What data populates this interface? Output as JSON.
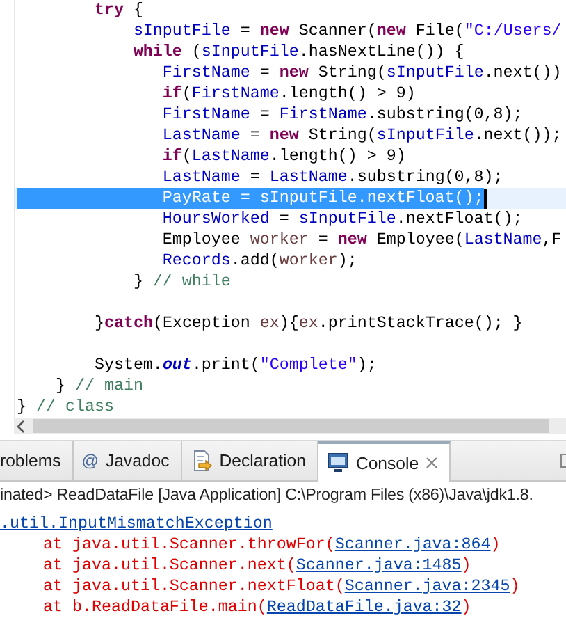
{
  "editor": {
    "lines": [
      {
        "kind": "code",
        "selected": false,
        "segments": [
          {
            "text": "        try",
            "kind": "keyword"
          },
          {
            "text": " {",
            "kind": "plain"
          }
        ]
      },
      {
        "kind": "code",
        "selected": false,
        "segments": [
          {
            "text": "            sInputFile",
            "kind": "field"
          },
          {
            "text": " = ",
            "kind": "plain"
          },
          {
            "text": "new",
            "kind": "keyword"
          },
          {
            "text": " Scanner(",
            "kind": "plain"
          },
          {
            "text": "new",
            "kind": "keyword"
          },
          {
            "text": " File(",
            "kind": "plain"
          },
          {
            "text": "\"C:/Users/",
            "kind": "string"
          }
        ]
      },
      {
        "kind": "code",
        "selected": false,
        "segments": [
          {
            "text": "            while",
            "kind": "keyword"
          },
          {
            "text": " (",
            "kind": "plain"
          },
          {
            "text": "sInputFile",
            "kind": "field"
          },
          {
            "text": ".hasNextLine()) {",
            "kind": "plain"
          }
        ]
      },
      {
        "kind": "code",
        "selected": false,
        "segments": [
          {
            "text": "               FirstName",
            "kind": "field"
          },
          {
            "text": " = ",
            "kind": "plain"
          },
          {
            "text": "new",
            "kind": "keyword"
          },
          {
            "text": " String(",
            "kind": "plain"
          },
          {
            "text": "sInputFile",
            "kind": "field"
          },
          {
            "text": ".next())",
            "kind": "plain"
          }
        ]
      },
      {
        "kind": "code",
        "selected": false,
        "segments": [
          {
            "text": "               if",
            "kind": "keyword"
          },
          {
            "text": "(",
            "kind": "plain"
          },
          {
            "text": "FirstName",
            "kind": "field"
          },
          {
            "text": ".length() > 9)",
            "kind": "plain"
          }
        ]
      },
      {
        "kind": "code",
        "selected": false,
        "segments": [
          {
            "text": "               FirstName",
            "kind": "field"
          },
          {
            "text": " = ",
            "kind": "plain"
          },
          {
            "text": "FirstName",
            "kind": "field"
          },
          {
            "text": ".substring(0,8);",
            "kind": "plain"
          }
        ]
      },
      {
        "kind": "code",
        "selected": false,
        "segments": [
          {
            "text": "               LastName",
            "kind": "field"
          },
          {
            "text": " = ",
            "kind": "plain"
          },
          {
            "text": "new",
            "kind": "keyword"
          },
          {
            "text": " String(",
            "kind": "plain"
          },
          {
            "text": "sInputFile",
            "kind": "field"
          },
          {
            "text": ".next());",
            "kind": "plain"
          }
        ]
      },
      {
        "kind": "code",
        "selected": false,
        "segments": [
          {
            "text": "               if",
            "kind": "keyword"
          },
          {
            "text": "(",
            "kind": "plain"
          },
          {
            "text": "LastName",
            "kind": "field"
          },
          {
            "text": ".length() > 9)",
            "kind": "plain"
          }
        ]
      },
      {
        "kind": "code",
        "selected": false,
        "segments": [
          {
            "text": "               LastName",
            "kind": "field"
          },
          {
            "text": " = ",
            "kind": "plain"
          },
          {
            "text": "LastName",
            "kind": "field"
          },
          {
            "text": ".substring(0,8);",
            "kind": "plain"
          }
        ]
      },
      {
        "kind": "code",
        "selected": true,
        "segments": [
          {
            "text": "               PayRate",
            "kind": "field"
          },
          {
            "text": " = ",
            "kind": "plain"
          },
          {
            "text": "sInputFile",
            "kind": "field"
          },
          {
            "text": ".nextFloat();",
            "kind": "plain"
          }
        ]
      },
      {
        "kind": "code",
        "selected": false,
        "segments": [
          {
            "text": "               HoursWorked",
            "kind": "field"
          },
          {
            "text": " = ",
            "kind": "plain"
          },
          {
            "text": "sInputFile",
            "kind": "field"
          },
          {
            "text": ".nextFloat();",
            "kind": "plain"
          }
        ]
      },
      {
        "kind": "code",
        "selected": false,
        "segments": [
          {
            "text": "               Employee ",
            "kind": "plain"
          },
          {
            "text": "worker",
            "kind": "local"
          },
          {
            "text": " = ",
            "kind": "plain"
          },
          {
            "text": "new",
            "kind": "keyword"
          },
          {
            "text": " Employee(",
            "kind": "plain"
          },
          {
            "text": "LastName",
            "kind": "field"
          },
          {
            "text": ",F",
            "kind": "plain"
          }
        ]
      },
      {
        "kind": "code",
        "selected": false,
        "segments": [
          {
            "text": "               Records",
            "kind": "field"
          },
          {
            "text": ".add(",
            "kind": "plain"
          },
          {
            "text": "worker",
            "kind": "local"
          },
          {
            "text": ");",
            "kind": "plain"
          }
        ]
      },
      {
        "kind": "code",
        "selected": false,
        "segments": [
          {
            "text": "            } ",
            "kind": "plain"
          },
          {
            "text": "// while",
            "kind": "comment"
          }
        ]
      },
      {
        "kind": "blank"
      },
      {
        "kind": "code",
        "selected": false,
        "segments": [
          {
            "text": "        }",
            "kind": "plain"
          },
          {
            "text": "catch",
            "kind": "keyword"
          },
          {
            "text": "(Exception ",
            "kind": "plain"
          },
          {
            "text": "ex",
            "kind": "local"
          },
          {
            "text": "){",
            "kind": "plain"
          },
          {
            "text": "ex",
            "kind": "local"
          },
          {
            "text": ".printStackTrace(); }",
            "kind": "plain"
          }
        ]
      },
      {
        "kind": "blank"
      },
      {
        "kind": "code",
        "selected": false,
        "segments": [
          {
            "text": "        System.",
            "kind": "plain"
          },
          {
            "text": "out",
            "kind": "static"
          },
          {
            "text": ".print(",
            "kind": "plain"
          },
          {
            "text": "\"Complete\"",
            "kind": "string"
          },
          {
            "text": ");",
            "kind": "plain"
          }
        ]
      },
      {
        "kind": "code",
        "selected": false,
        "segments": [
          {
            "text": "    } ",
            "kind": "plain"
          },
          {
            "text": "// main",
            "kind": "comment"
          }
        ]
      },
      {
        "kind": "code",
        "selected": false,
        "segments": [
          {
            "text": "} ",
            "kind": "plain"
          },
          {
            "text": "// class",
            "kind": "comment"
          }
        ]
      }
    ]
  },
  "tabs": [
    {
      "kind": "problems",
      "label": "roblems",
      "selected": false
    },
    {
      "kind": "javadoc",
      "glyph": "@",
      "label": "Javadoc",
      "selected": false
    },
    {
      "kind": "declaration",
      "label": "Declaration",
      "selected": false
    },
    {
      "kind": "console",
      "label": "Console",
      "selected": true
    }
  ],
  "console": {
    "header": "inated> ReadDataFile [Java Application] C:\\Program Files (x86)\\Java\\jdk1.8.",
    "exception": ".util.InputMismatchException",
    "stack": [
      {
        "prefix": "at java.util.Scanner.throwFor(",
        "link": "Scanner.java:864",
        "suffix": ")"
      },
      {
        "prefix": "at java.util.Scanner.next(",
        "link": "Scanner.java:1485",
        "suffix": ")"
      },
      {
        "prefix": "at java.util.Scanner.nextFloat(",
        "link": "Scanner.java:2345",
        "suffix": ")"
      },
      {
        "prefix": "at b.ReadDataFile.main(",
        "link": "ReadDataFile.java:32",
        "suffix": ")"
      }
    ]
  }
}
